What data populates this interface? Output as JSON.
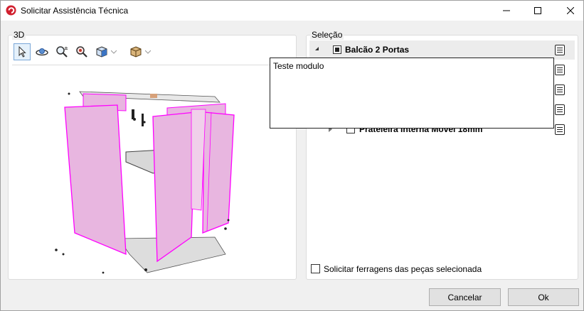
{
  "window": {
    "title": "Solicitar Assistência Técnica",
    "app_icon": "app-logo-icon",
    "controls": [
      "minimize-icon",
      "maximize-icon",
      "close-icon"
    ]
  },
  "panel_3d": {
    "label": "3D",
    "toolbar": [
      {
        "name": "select-tool",
        "icon": "cursor-arrow-icon",
        "active": true
      },
      {
        "name": "orbit-tool",
        "icon": "orbit-icon"
      },
      {
        "name": "zoom-tool",
        "icon": "zoom-plus-minus-icon"
      },
      {
        "name": "zoom-fit-tool",
        "icon": "zoom-fit-icon"
      },
      {
        "name": "view-cube-tool",
        "icon": "view-cube-icon",
        "dropdown": true
      },
      {
        "name": "box-view-tool",
        "icon": "box-view-icon",
        "dropdown": true
      }
    ],
    "viewport_icon": "cabinet-3d-model"
  },
  "panel_selection": {
    "label": "Seleção",
    "tree": [
      {
        "label": "Balcão 2 Portas",
        "level": 0,
        "expanded": true,
        "checked": "partial",
        "selected": true
      },
      {
        "label": "",
        "level": 1,
        "hidden_by_tooltip": true
      },
      {
        "label": "",
        "level": 1,
        "hidden_by_tooltip": true
      },
      {
        "label": "",
        "level": 1,
        "hidden_by_tooltip": true
      },
      {
        "label": "Prateleira Interna Móvel 18mm",
        "level": 1,
        "expanded": false,
        "checked": false
      }
    ],
    "detail_icon": "list-detail-icon",
    "tooltip": "Teste modulo",
    "hardware_checkbox": {
      "label": "Solicitar ferragens das peças selecionada",
      "checked": false
    }
  },
  "buttons": {
    "cancel": "Cancelar",
    "ok": "Ok"
  },
  "colors": {
    "panel_pink": "#e8b6e0",
    "panel_edge": "#ff00ff",
    "shelf_gray": "#d8d8d8",
    "window_bg": "#f0f0f0"
  }
}
